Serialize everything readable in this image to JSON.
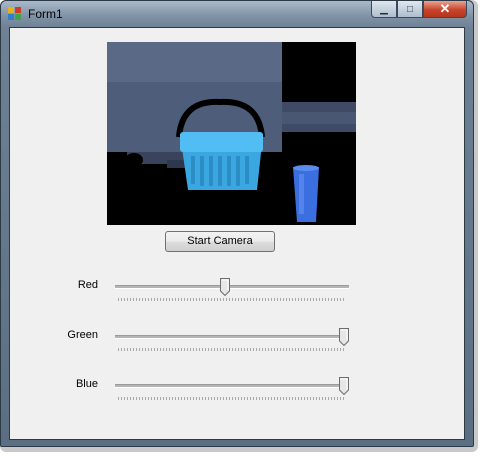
{
  "window": {
    "title": "Form1",
    "minimize_glyph": "▁",
    "maximize_glyph": "□",
    "close_glyph": "✕",
    "icon": "winforms-app-icon"
  },
  "camera": {
    "description_icon": "camera-preview",
    "button_label": "Start Camera"
  },
  "sliders": [
    {
      "label": "Red",
      "value_fraction": 0.47
    },
    {
      "label": "Green",
      "value_fraction": 1.0
    },
    {
      "label": "Blue",
      "value_fraction": 1.0
    }
  ],
  "colors": {
    "accent_close": "#c8452a",
    "client_bg": "#f0f0f0"
  }
}
